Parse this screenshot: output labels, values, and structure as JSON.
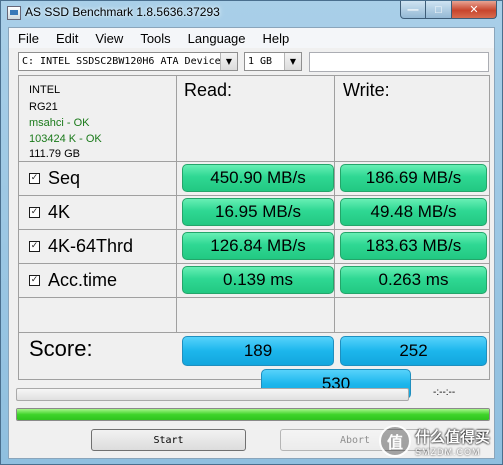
{
  "window": {
    "title": "AS SSD Benchmark 1.8.5636.37293"
  },
  "menu": {
    "items": [
      "File",
      "Edit",
      "View",
      "Tools",
      "Language",
      "Help"
    ]
  },
  "drive_select": {
    "value": "C: INTEL SSDSC2BW120H6 ATA Device"
  },
  "size_select": {
    "value": "1 GB"
  },
  "info": {
    "vendor": "INTEL",
    "firmware": "RG21",
    "driver": "msahci - OK",
    "alignment": "103424 K - OK",
    "capacity": "111.79 GB"
  },
  "headers": {
    "read": "Read:",
    "write": "Write:"
  },
  "rows": [
    {
      "label": "Seq",
      "checked": true,
      "read": "450.90 MB/s",
      "write": "186.69 MB/s"
    },
    {
      "label": "4K",
      "checked": true,
      "read": "16.95 MB/s",
      "write": "49.48 MB/s"
    },
    {
      "label": "4K-64Thrd",
      "checked": true,
      "read": "126.84 MB/s",
      "write": "183.63 MB/s"
    },
    {
      "label": "Acc.time",
      "checked": true,
      "read": "0.139 ms",
      "write": "0.263 ms"
    }
  ],
  "score": {
    "label": "Score:",
    "read": "189",
    "write": "252",
    "total": "530"
  },
  "progress": {
    "timer": "-:--:--",
    "overall_fraction": 1.0
  },
  "buttons": {
    "start": "Start",
    "abort": "Abort"
  },
  "watermark": {
    "logo": "值",
    "main": "什么值得买",
    "sub": "SMZDM.COM"
  },
  "colors": {
    "result_green": "#2fd893",
    "score_blue": "#1cb6ec",
    "progress_green": "#3fd42a",
    "driver_ok": "#1a7a1a"
  },
  "icons": {
    "check": "checkmark-icon",
    "dropdown": "chevron-down-icon"
  }
}
